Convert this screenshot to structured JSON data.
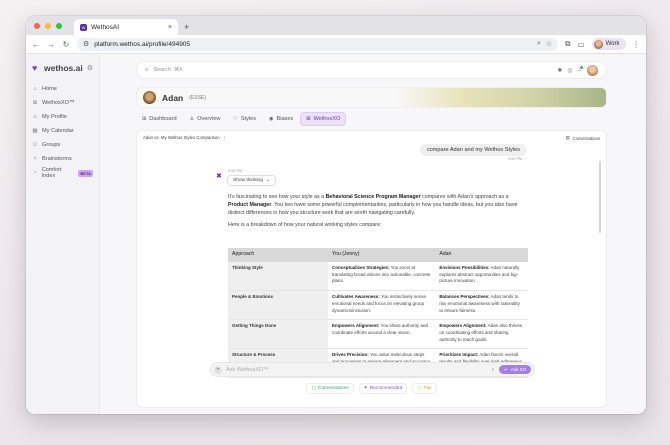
{
  "browser": {
    "tab_title": "WethosAI",
    "tab_close": "×",
    "new_tab": "+",
    "url": "platform.wethos.ai/profile/494905",
    "profile_label": "Work"
  },
  "sidebar": {
    "brand": "wethos.ai",
    "items": [
      {
        "label": "Home",
        "icon": "house-icon"
      },
      {
        "label": "WethosXO™",
        "icon": "xo-icon"
      },
      {
        "label": "My Profile",
        "icon": "user-icon"
      },
      {
        "label": "My Calendar",
        "icon": "calendar-icon"
      },
      {
        "label": "Groups",
        "icon": "groups-icon"
      },
      {
        "label": "Brainstorms",
        "icon": "bulb-icon"
      },
      {
        "label": "Comfort Index",
        "icon": "comfort-icon"
      }
    ],
    "beta_badge": "BETA"
  },
  "search": {
    "placeholder": "Search",
    "shortcut": "⌘K"
  },
  "profile": {
    "name": "Adan",
    "tag": "(ESSE)"
  },
  "tabs": [
    {
      "label": "Dashboard"
    },
    {
      "label": "Overview"
    },
    {
      "label": "Styles"
    },
    {
      "label": "Biases"
    },
    {
      "label": "WethosXO"
    }
  ],
  "chat": {
    "title": "Adan vs. My Wethos Styles Comparison",
    "conversations_label": "Conversations",
    "user_message": "compare Adan and my Wethos Styles",
    "user_time": "9:00 PM",
    "ai_time": "9:00 PM",
    "show_thinking": "Show thinking",
    "para1_a": "It's fascinating to see how your style as a ",
    "para1_b": "Behavioral Science Program Manager",
    "para1_c": " compares with Adan's approach as a ",
    "para1_d": "Product Manager",
    "para1_e": ". You two have some powerful complementarities, particularly in how you handle ideas, but you also have distinct differences in how you structure work that are worth navigating carefully.",
    "para2": "Here is a breakdown of how your natural working styles compare:",
    "table": {
      "headers": [
        "Approach",
        "You (Jenny)",
        "Adan"
      ],
      "rows": [
        {
          "approach": "Thinking Style",
          "you_title": "Conceptualizes Strategies:",
          "you_text": " You excel at translating broad visions into actionable, concrete plans.",
          "adan_title": "Envisions Possibilities:",
          "adan_text": " Adan naturally explores abstract opportunities and big-picture innovation."
        },
        {
          "approach": "People & Emotions",
          "you_title": "Cultivates Awareness:",
          "you_text": " You instinctively sense emotional needs and focus on elevating group dynamics/inclusion.",
          "adan_title": "Balances Perspectives:",
          "adan_text": " Adan tends to mix emotional awareness with rationality to ensure fairness."
        },
        {
          "approach": "Getting Things Done",
          "you_title": "Empowers Alignment:",
          "you_text": " You share authority and coordinate efforts around a clear vision.",
          "adan_title": "Empowers Alignment:",
          "adan_text": " Adan also thrives on coordinating efforts and sharing authority to reach goals."
        },
        {
          "approach": "Structure & Process",
          "you_title": "Drives Precision:",
          "you_text": " You value meticulous steps and processes to ensure alignment and accuracy.",
          "adan_title": "Prioritizes Impact:",
          "adan_text": " Adan favors overall results and flexibility over rigid adherence to process."
        }
      ]
    },
    "composer_placeholder": "Ask WethosXO™",
    "ask_button": "Ask XO"
  },
  "bottom_links": [
    {
      "label": "Conversations"
    },
    {
      "label": "Recommended"
    },
    {
      "label": "Fav"
    }
  ],
  "colors": {
    "accent": "#7b3fd0",
    "ask_button": "#a77ee8"
  }
}
